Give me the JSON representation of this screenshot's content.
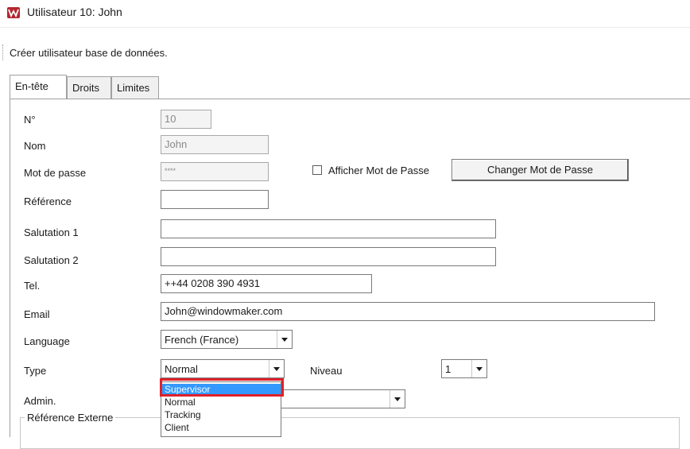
{
  "window": {
    "title": "Utilisateur 10: John"
  },
  "toolbar": {
    "text": "Créer  utilisateur base de données."
  },
  "tabs": [
    {
      "label": "En-tête",
      "active": true
    },
    {
      "label": "Droits",
      "active": false
    },
    {
      "label": "Limites",
      "active": false
    }
  ],
  "form": {
    "number": {
      "label": "N°",
      "value": "10"
    },
    "name": {
      "label": "Nom",
      "value": "John"
    },
    "password": {
      "label": "Mot de passe",
      "value": "****"
    },
    "show_password": {
      "label": "Afficher Mot de Passe",
      "checked": false
    },
    "change_password_button": "Changer Mot de Passe",
    "reference": {
      "label": "Référence",
      "value": ""
    },
    "salutation1": {
      "label": "Salutation 1",
      "value": ""
    },
    "salutation2": {
      "label": "Salutation 2",
      "value": ""
    },
    "tel": {
      "label": "Tel.",
      "value": "++44 0208 390 4931"
    },
    "email": {
      "label": "Email",
      "value": "John@windowmaker.com"
    },
    "language": {
      "label": "Language",
      "value": "French (France)"
    },
    "type": {
      "label": "Type",
      "value": "Normal",
      "options": [
        "Supervisor",
        "Normal",
        "Tracking",
        "Client"
      ],
      "highlighted": "Supervisor"
    },
    "niveau": {
      "label": "Niveau",
      "value": "1"
    },
    "admin": {
      "label": "Admin.",
      "value": ""
    },
    "external_reference": {
      "label": "Référence Externe"
    }
  },
  "colors": {
    "selection": "#3399ff",
    "highlight_box": "#e0202a"
  }
}
